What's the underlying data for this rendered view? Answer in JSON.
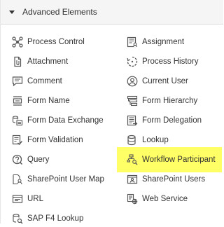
{
  "panel": {
    "header": {
      "title": "Advanced Elements"
    },
    "highlight_color": "#ffff66",
    "items_left": [
      {
        "label": "Process Control",
        "icon": "process-control-icon"
      },
      {
        "label": "Attachment",
        "icon": "attachment-icon"
      },
      {
        "label": "Comment",
        "icon": "comment-icon"
      },
      {
        "label": "Form Name",
        "icon": "form-name-icon"
      },
      {
        "label": "Form Data Exchange",
        "icon": "form-data-exchange-icon"
      },
      {
        "label": "Form Validation",
        "icon": "form-validation-icon"
      },
      {
        "label": "Query",
        "icon": "query-icon"
      },
      {
        "label": "SharePoint User Map",
        "icon": "sharepoint-user-map-icon"
      },
      {
        "label": "URL",
        "icon": "url-icon"
      },
      {
        "label": "SAP F4 Lookup",
        "icon": "sap-f4-lookup-icon"
      }
    ],
    "items_right": [
      {
        "label": "Assignment",
        "icon": "assignment-icon"
      },
      {
        "label": "Process History",
        "icon": "process-history-icon"
      },
      {
        "label": "Current User",
        "icon": "current-user-icon"
      },
      {
        "label": "Form Hierarchy",
        "icon": "form-hierarchy-icon"
      },
      {
        "label": "Form Delegation",
        "icon": "form-delegation-icon"
      },
      {
        "label": "Lookup",
        "icon": "lookup-icon"
      },
      {
        "label": "Workflow Participant",
        "icon": "workflow-participant-icon"
      },
      {
        "label": "SharePoint Users",
        "icon": "sharepoint-users-icon"
      },
      {
        "label": "Web Service",
        "icon": "web-service-icon"
      }
    ]
  }
}
